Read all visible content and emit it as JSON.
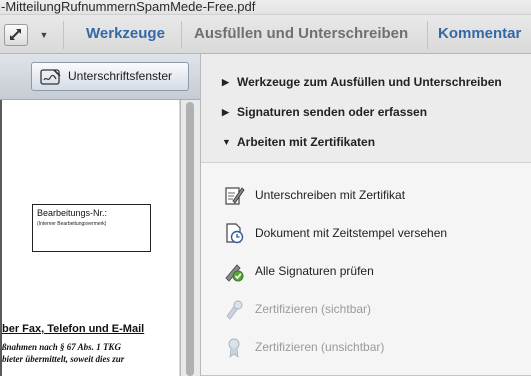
{
  "window": {
    "title": "-MitteilungRufnummernSpamMede-Free.pdf"
  },
  "toolbar": {
    "tabs": [
      {
        "label": "Werkzeuge"
      },
      {
        "label": "Ausfüllen und Unterschreiben"
      },
      {
        "label": "Kommentar"
      }
    ]
  },
  "doc_toolbar": {
    "signature_window_label": "Unterschriftsfenster"
  },
  "document": {
    "box_label": "Bearbeitungs-Nr.:",
    "box_sublabel": "(Interner Bearbeitungsvermerk)",
    "heading": "ber Fax, Telefon und E-Mail",
    "lines": [
      "ßnahmen nach § 67 Abs. 1 TKG",
      "bieter übermittelt, soweit dies zur"
    ]
  },
  "sidebar": {
    "sections": [
      {
        "label": "Werkzeuge zum Ausfüllen und Unterschreiben",
        "expanded": false
      },
      {
        "label": "Signaturen senden oder erfassen",
        "expanded": false
      },
      {
        "label": "Arbeiten mit Zertifikaten",
        "expanded": true
      }
    ],
    "certificate_items": [
      {
        "label": "Unterschreiben mit Zertifikat",
        "icon": "sign-certificate-icon",
        "enabled": true
      },
      {
        "label": "Dokument mit Zeitstempel versehen",
        "icon": "timestamp-icon",
        "enabled": true
      },
      {
        "label": "Alle Signaturen prüfen",
        "icon": "validate-signatures-icon",
        "enabled": true
      },
      {
        "label": "Zertifizieren (sichtbar)",
        "icon": "certify-visible-icon",
        "enabled": false
      },
      {
        "label": "Zertifizieren (unsichtbar)",
        "icon": "certify-invisible-icon",
        "enabled": false
      }
    ]
  },
  "colors": {
    "tab_active": "#3568a6",
    "tab_inactive": "#707070",
    "disabled_text": "#9a9a9a"
  }
}
